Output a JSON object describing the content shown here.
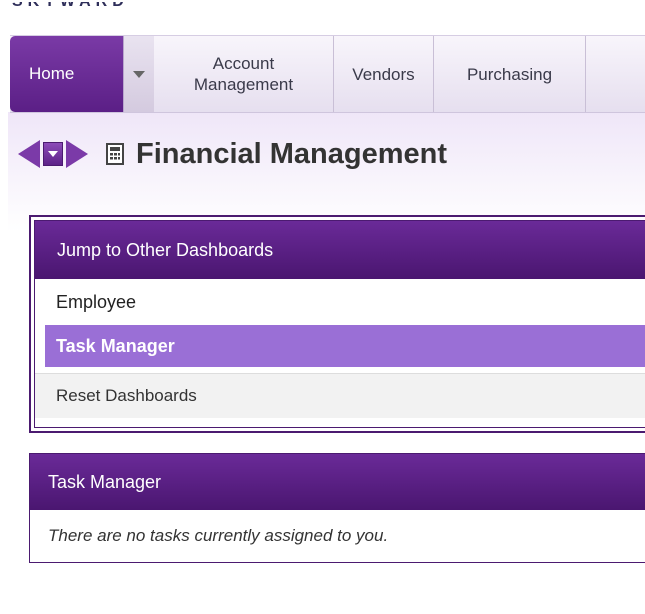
{
  "app": {
    "logo_text": "SKYWARD"
  },
  "navbar": {
    "home_label": "Home",
    "items": [
      {
        "label_line1": "Account",
        "label_line2": "Management"
      },
      {
        "label": "Vendors"
      },
      {
        "label": "Purchasing"
      }
    ]
  },
  "page": {
    "title": "Financial Management",
    "icon": "calculator-icon"
  },
  "jump_panel": {
    "header": "Jump to Other Dashboards",
    "items": [
      {
        "label": "Employee",
        "selected": false
      },
      {
        "label": "Task Manager",
        "selected": true
      }
    ],
    "reset_label": "Reset Dashboards"
  },
  "task_panel": {
    "header": "Task Manager",
    "message": "There are no tasks currently assigned to you."
  },
  "colors": {
    "accent": "#5b1f86",
    "selected_bg": "#9a6fd6",
    "header_bg": "#4a1670"
  }
}
